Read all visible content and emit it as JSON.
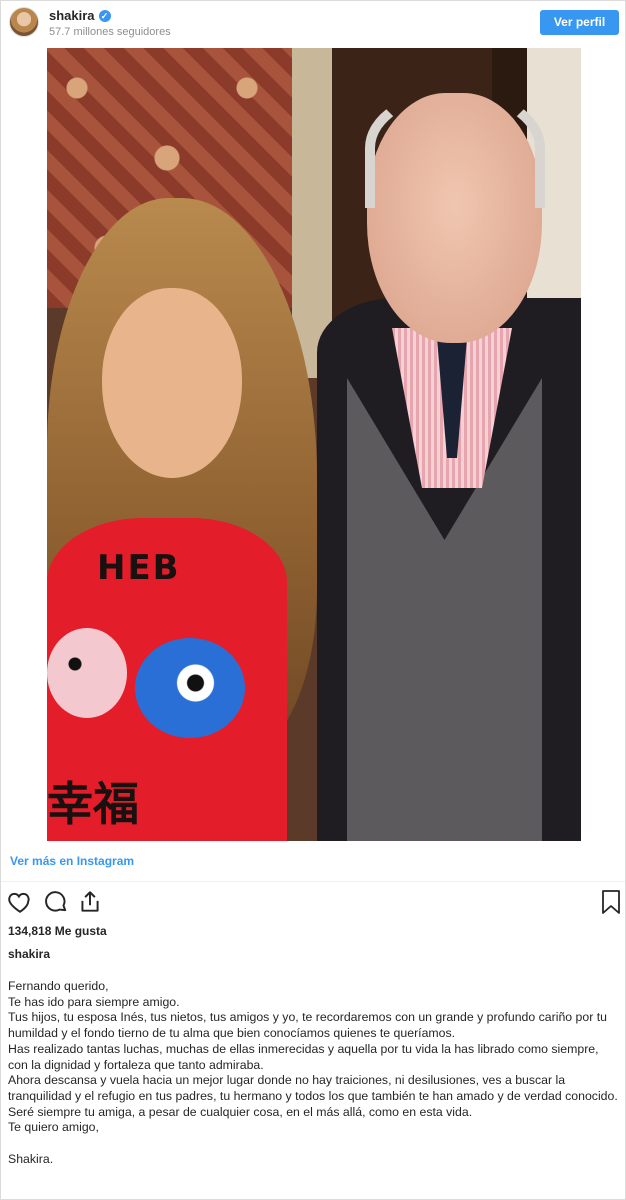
{
  "header": {
    "username": "shakira",
    "verified_icon": "verified-check-icon",
    "followers": "57.7 millones seguidores",
    "view_profile_label": "Ver perfil"
  },
  "post": {
    "image_alt": "photo-shakira-and-man",
    "view_more_label": "Ver más en Instagram",
    "likes": "134,818 Me gusta",
    "caption_username": "shakira",
    "caption_lines": [
      "Fernando querido,",
      "Te has ido para siempre amigo.",
      "Tus hijos, tu esposa Inés, tus nietos, tus amigos y yo, te recordaremos con un grande y profundo cariño por tu humildad y el fondo tierno de tu alma que bien conocíamos quienes te queríamos.",
      "Has realizado tantas luchas, muchas de ellas inmerecidas y aquella por tu vida la has librado como siempre, con la dignidad y fortaleza que tanto admiraba.",
      "Ahora descansa y vuela hacia un mejor lugar donde no hay traiciones, ni desilusiones, ves a buscar la tranquilidad y el refugio en tus padres, tu hermano y todos los que también te han amado y de verdad conocido.",
      "Seré siempre tu amiga, a pesar de cualquier cosa, en el más allá, como en esta vida.",
      "Te quiero amigo,"
    ],
    "signoff": "Shakira.",
    "shirt_text": "HEB",
    "shirt_han": "幸福"
  },
  "icons": {
    "like": "heart-icon",
    "comment": "comment-icon",
    "share": "share-icon",
    "save": "bookmark-icon"
  },
  "colors": {
    "accent": "#3897f0",
    "text": "#262626",
    "muted": "#8e8e8e"
  }
}
